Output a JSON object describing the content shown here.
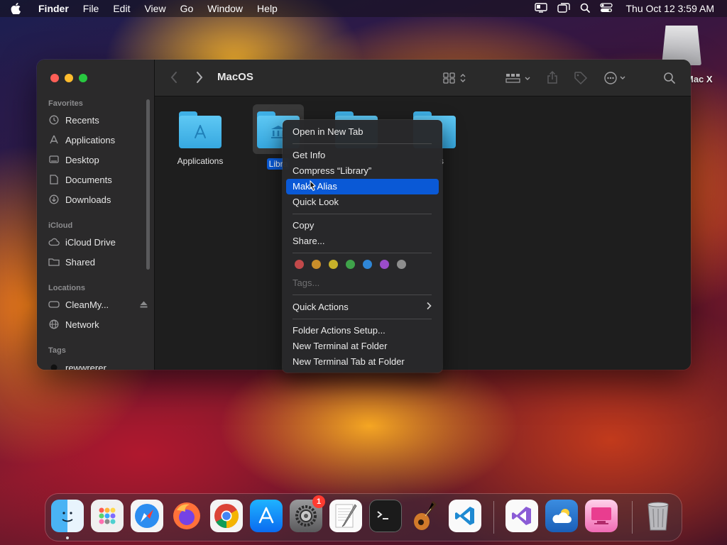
{
  "menubar": {
    "app": "Finder",
    "items": [
      "File",
      "Edit",
      "View",
      "Go",
      "Window",
      "Help"
    ],
    "clock": "Thu Oct 12  3:59 AM",
    "status_icons": [
      "screen-mirroring-icon",
      "window-icon",
      "search-icon",
      "control-center-icon"
    ]
  },
  "desktop": {
    "disk_label": "Mac X"
  },
  "finder": {
    "title": "MacOS",
    "sidebar": {
      "favorites_header": "Favorites",
      "favorites": [
        {
          "label": "Recents",
          "icon": "clock-icon"
        },
        {
          "label": "Applications",
          "icon": "applications-icon"
        },
        {
          "label": "Desktop",
          "icon": "desktop-icon"
        },
        {
          "label": "Documents",
          "icon": "document-icon"
        },
        {
          "label": "Downloads",
          "icon": "download-icon"
        }
      ],
      "icloud_header": "iCloud",
      "icloud": [
        {
          "label": "iCloud Drive",
          "icon": "cloud-icon"
        },
        {
          "label": "Shared",
          "icon": "shared-folder-icon"
        }
      ],
      "locations_header": "Locations",
      "locations": [
        {
          "label": "CleanMy...",
          "icon": "drive-icon"
        },
        {
          "label": "Network",
          "icon": "globe-icon"
        }
      ],
      "tags_header": "Tags",
      "tags": [
        {
          "label": "rewwrerer",
          "icon": "tag-dot-icon"
        }
      ]
    },
    "files": [
      {
        "name": "Applications"
      },
      {
        "name": "Libra"
      },
      {
        "name": ""
      },
      {
        "name": "s"
      }
    ]
  },
  "context_menu": {
    "items": {
      "open_new_tab": "Open in New Tab",
      "get_info": "Get Info",
      "compress": "Compress “Library”",
      "make_alias": "Make Alias",
      "quick_look": "Quick Look",
      "copy": "Copy",
      "share": "Share...",
      "tags": "Tags...",
      "quick_actions": "Quick Actions",
      "folder_actions": "Folder Actions Setup...",
      "new_terminal": "New Terminal at Folder",
      "new_terminal_tab": "New Terminal Tab at Folder"
    },
    "tag_colors": [
      "#c2494a",
      "#c98e2a",
      "#c7b12a",
      "#3fa34a",
      "#2f86d6",
      "#9a4cc9",
      "#8e8e8e"
    ],
    "highlight_color": "#0a59d6"
  },
  "dock": {
    "settings_badge": "1",
    "apps": [
      "finder-icon",
      "launchpad-icon",
      "safari-icon",
      "firefox-icon",
      "chrome-icon",
      "app-store-icon",
      "system-settings-icon",
      "textedit-icon",
      "terminal-icon",
      "garageband-icon",
      "vscode-icon",
      "visual-studio-icon",
      "weather-icon",
      "cleanmymac-icon",
      "trash-icon"
    ]
  }
}
